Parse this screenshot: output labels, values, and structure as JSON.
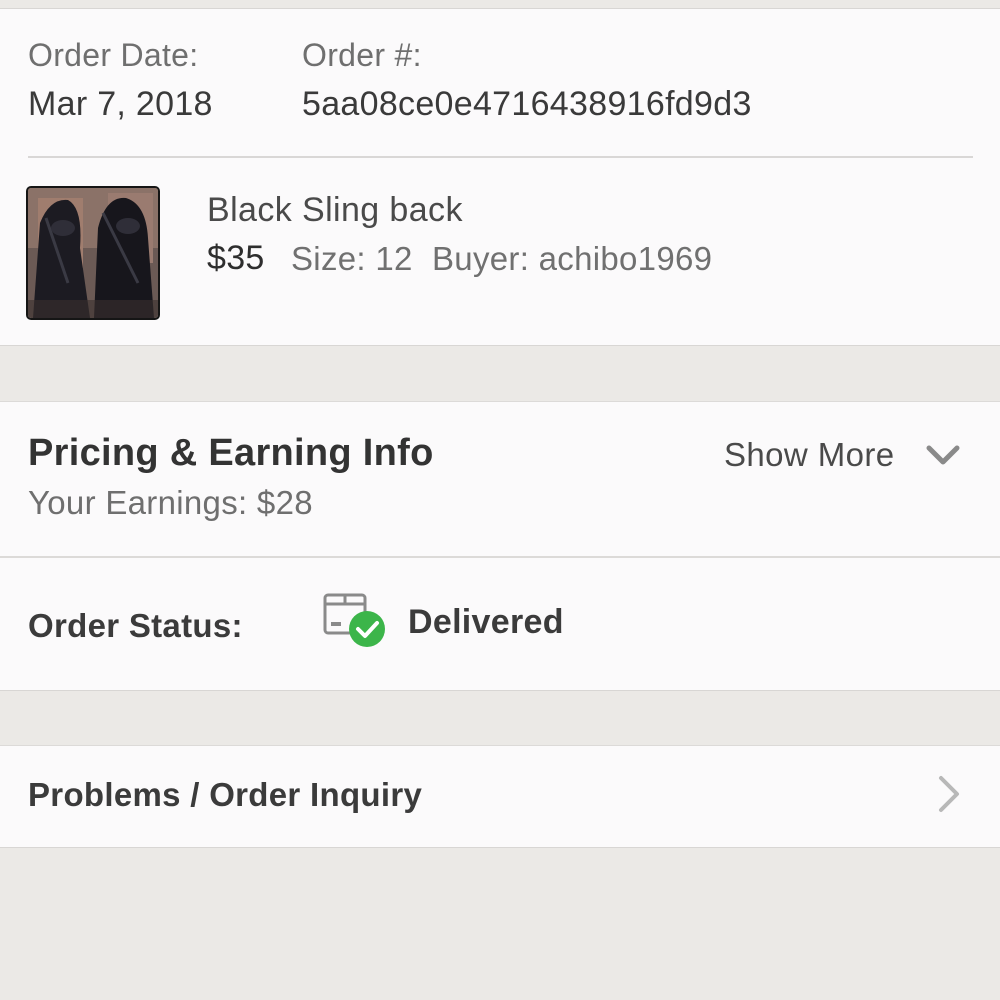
{
  "order": {
    "date_label": "Order Date:",
    "date_value": "Mar 7, 2018",
    "number_label": "Order #:",
    "number_value": "5aa08ce0e4716438916fd9d3"
  },
  "item": {
    "title": "Black Sling back",
    "price": "$35",
    "size": "Size: 12",
    "buyer": "Buyer: achibo1969",
    "thumbnail_icon": "shoe-photo"
  },
  "pricing": {
    "title": "Pricing & Earning Info",
    "earnings": "Your Earnings: $28",
    "show_more": "Show More",
    "show_more_icon": "chevron-down-icon"
  },
  "status": {
    "label": "Order Status:",
    "value": "Delivered",
    "icon": "package-delivered-icon",
    "check_color": "#3cb54a"
  },
  "problems": {
    "label": "Problems / Order Inquiry",
    "icon": "chevron-right-icon"
  }
}
